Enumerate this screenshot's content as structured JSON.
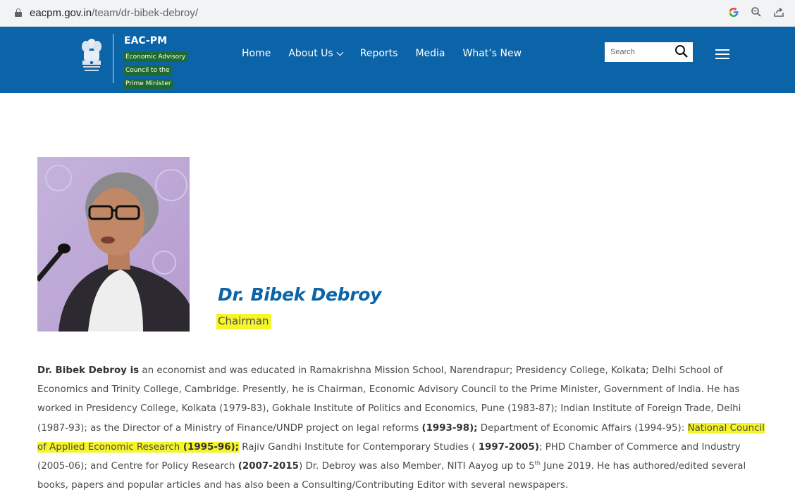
{
  "browser": {
    "url_host": "eacpm.gov.in",
    "url_path": "/team/dr-bibek-debroy/"
  },
  "header": {
    "brand_title": "EAC-PM",
    "brand_subtitle_lines": [
      "Economic Advisory",
      "Council to the",
      "Prime Minister"
    ],
    "nav": [
      {
        "label": "Home"
      },
      {
        "label": "About Us",
        "has_dropdown": true
      },
      {
        "label": "Reports"
      },
      {
        "label": "Media"
      },
      {
        "label": "What’s New"
      }
    ],
    "search_placeholder": "Search"
  },
  "profile": {
    "name": "Dr. Bibek Debroy",
    "role": "Chairman"
  },
  "bio": {
    "p1_bold": "Dr. Bibek Debroy is",
    "p1_text": " an economist and was educated in Ramakrishna Mission School, Narendrapur; Presidency College, Kolkata; Delhi School of Economics and Trinity College, Cambridge. Presently, he is Chairman, Economic Advisory Council to the Prime Minister, Government of India. He has worked in Presidency College, Kolkata (1979-83), Gokhale Institute of Politics and Economics, Pune (1983-87); Indian Institute of Foreign Trade, Delhi (1987-93); as the Director of a Ministry of Finance/UNDP project on legal reforms ",
    "p2_bold": "(1993-98);",
    "p2_text": " Department of Economic Affairs (1994-95): ",
    "p3_highlight": "National Council of Applied Economic Research",
    "p3_bold": " (1995-96);",
    "p3_text": " Rajiv Gandhi Institute for Contemporary Studies      ( ",
    "p4_bold": "1997-2005)",
    "p4_text": "; PHD Chamber of Commerce  and  Industry (2005-06); and Centre for Policy Research ",
    "p5_bold": "(2007-2015",
    "p5_text": ") Dr. Debroy was also Member, NITI Aayog up to 5",
    "p5_sup": "th",
    "p6_text": " June 2019.  He has authored/edited several books, papers and popular  articles  and  has also been a Consulting/Contributing Editor with several newspapers."
  },
  "colors": {
    "header_bg": "#0b63a8",
    "highlight": "#f5f52a",
    "name_color": "#0b63a8",
    "brand_sub_bg": "#1e6b2f"
  }
}
